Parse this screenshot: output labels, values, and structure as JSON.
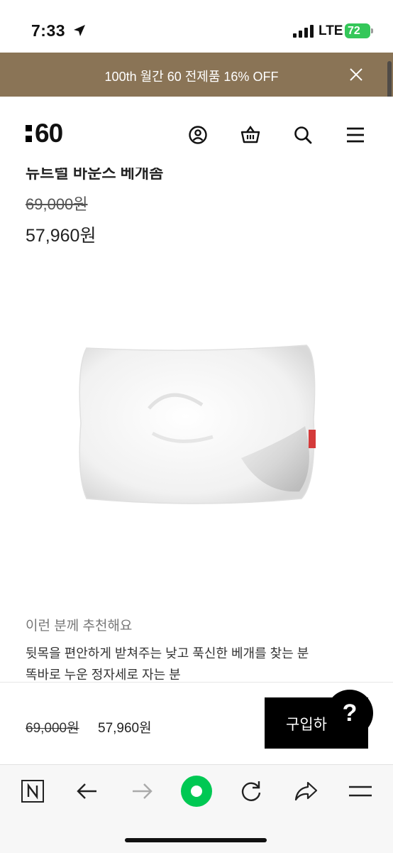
{
  "status_bar": {
    "time": "7:33",
    "network": "LTE",
    "battery": "72"
  },
  "promo": {
    "text": "100th 월간 60 전제품 16% OFF"
  },
  "header": {
    "logo_digits": "60",
    "icons": [
      "user-icon",
      "basket-icon",
      "search-icon",
      "menu-icon"
    ]
  },
  "product": {
    "name": "뉴트럴 바운스 베개솜",
    "original_price": "69,000원",
    "sale_price": "57,960원"
  },
  "recommend": {
    "title": "이런 분께 추천해요",
    "lines": [
      "뒷목을 편안하게 받쳐주는 낮고 푹신한 베개를 찾는 분",
      "똑바로 누운 정자세로 자는 분"
    ]
  },
  "buy_bar": {
    "original_price": "69,000원",
    "sale_price": "57,960원",
    "button_label": "구입하",
    "help_label": "?"
  },
  "browser_bar": {
    "icons": [
      "naver-home-icon",
      "back-arrow-icon",
      "forward-arrow-icon",
      "green-dot-icon",
      "refresh-icon",
      "share-icon",
      "menu-icon"
    ]
  },
  "colors": {
    "promo_bg": "#8a7456",
    "accent_green": "#00c853",
    "battery_green": "#34c759"
  }
}
